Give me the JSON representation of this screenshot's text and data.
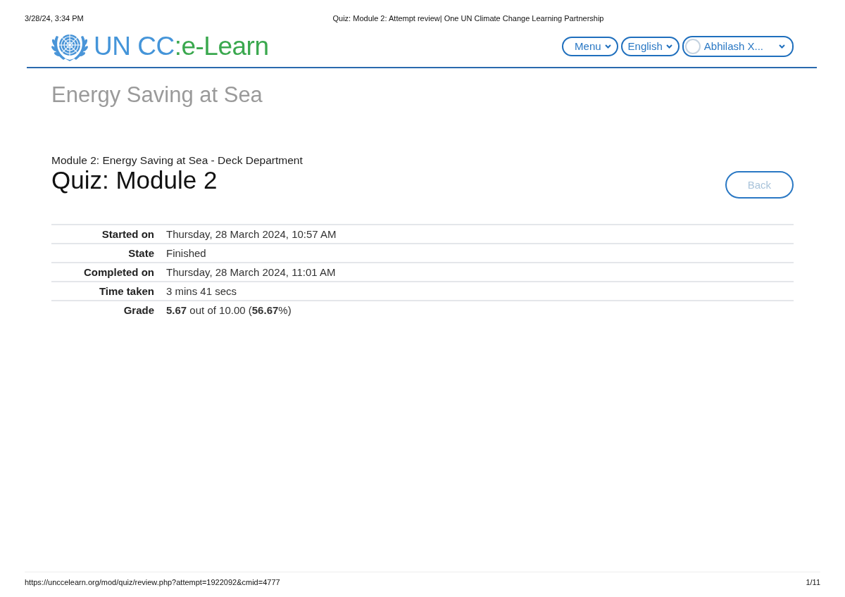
{
  "print_header": {
    "date": "3/28/24, 3:34 PM",
    "title": "Quiz: Module 2: Attempt review| One UN Climate Change Learning Partnership"
  },
  "site_header": {
    "logo": {
      "primary_part": "UN CC",
      "accent_part": ":e-Learn"
    },
    "nav_buttons": [
      {
        "label": "Menu",
        "kind": "dropdown"
      },
      {
        "label": "English",
        "kind": "dropdown"
      },
      {
        "label": "Abhilash X...",
        "kind": "user"
      }
    ]
  },
  "course_title": "Energy Saving at Sea",
  "section_title": "Module 2: Energy Saving at Sea - Deck Department",
  "page_title": "Quiz: Module 2",
  "back_button": {
    "label": "Back"
  },
  "summary": [
    {
      "label": "Started on",
      "value": "Thursday, 28 March 2024, 10:57 AM"
    },
    {
      "label": "State",
      "value": "Finished"
    },
    {
      "label": "Completed on",
      "value": "Thursday, 28 March 2024, 11:01 AM"
    },
    {
      "label": "Time taken",
      "value": "3 mins 41 secs"
    },
    {
      "label": "Grade",
      "value": "**5.67** out of 10.00 (**56.67**%)"
    }
  ],
  "print_footer": {
    "url": "https://unccelearn.org/mod/quiz/review.php?attempt=1922092&cmid=4777",
    "page": "1/11"
  }
}
